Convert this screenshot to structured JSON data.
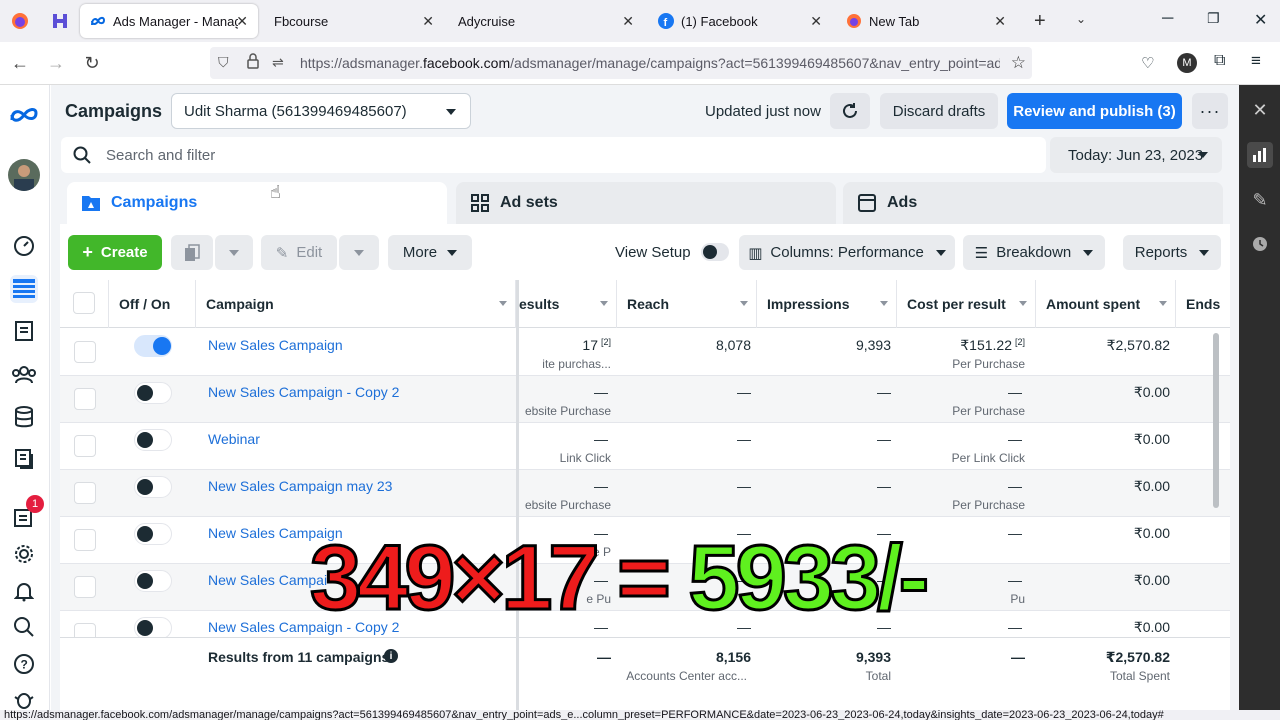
{
  "browser": {
    "tabs": [
      {
        "title": "Ads Manager - Manage",
        "active": true
      },
      {
        "title": "Fbcourse"
      },
      {
        "title": "Adycruise"
      },
      {
        "title": "(1) Facebook"
      },
      {
        "title": "New Tab"
      }
    ],
    "url": "https://adsmanager.facebook.com/adsmanager/manage/campaigns?act=561399469485607&nav_entry_point=ads",
    "url_prefix": "https://adsmanager.",
    "url_domain": "facebook.com",
    "url_suffix": "/adsmanager/manage/campaigns?act=561399469485607&nav_entry_point=ads",
    "profile_initial": "M",
    "status_url": "https://adsmanager.facebook.com/adsmanager/manage/campaigns?act=561399469485607&nav_entry_point=ads_e...column_preset=PERFORMANCE&date=2023-06-23_2023-06-24,today&insights_date=2023-06-23_2023-06-24,today#"
  },
  "sidebar": {
    "notification_count": "1"
  },
  "header": {
    "title": "Campaigns",
    "account": "Udit Sharma (561399469485607)",
    "updated": "Updated just now",
    "discard": "Discard drafts",
    "publish": "Review and publish (3)",
    "search_placeholder": "Search and filter",
    "date": "Today: Jun 23, 2023"
  },
  "level_tabs": {
    "campaigns": "Campaigns",
    "adsets": "Ad sets",
    "ads": "Ads"
  },
  "toolbar": {
    "create": "Create",
    "edit": "Edit",
    "more": "More",
    "view_setup": "View Setup",
    "columns": "Columns: Performance",
    "breakdown": "Breakdown",
    "reports": "Reports"
  },
  "table": {
    "headers": {
      "off_on": "Off / On",
      "campaign": "Campaign",
      "results": "esults",
      "reach": "Reach",
      "impressions": "Impressions",
      "cost": "Cost per result",
      "amount": "Amount spent",
      "ends": "Ends"
    },
    "rows": [
      {
        "name": "New Sales Campaign",
        "on": true,
        "results": "17",
        "results_sup": "[2]",
        "results_sub": "ite purchas...",
        "reach": "8,078",
        "impressions": "9,393",
        "cost": "₹151.22",
        "cost_sup": "[2]",
        "cost_sub": "Per Purchase",
        "amount": "₹2,570.82"
      },
      {
        "name": "New Sales Campaign - Copy 2",
        "on": false,
        "results": "—",
        "results_sup": "",
        "results_sub": "ebsite Purchase",
        "reach": "—",
        "impressions": "—",
        "cost": "—",
        "cost_sup": "",
        "cost_sub": "Per Purchase",
        "amount": "₹0.00"
      },
      {
        "name": "Webinar",
        "on": false,
        "results": "—",
        "results_sup": "",
        "results_sub": "Link Click",
        "reach": "—",
        "impressions": "—",
        "cost": "—",
        "cost_sup": "",
        "cost_sub": "Per Link Click",
        "amount": "₹0.00"
      },
      {
        "name": "New Sales Campaign may 23",
        "on": false,
        "results": "—",
        "results_sup": "",
        "results_sub": "ebsite Purchase",
        "reach": "—",
        "impressions": "—",
        "cost": "—",
        "cost_sup": "",
        "cost_sub": "Per Purchase",
        "amount": "₹0.00"
      },
      {
        "name": "New Sales Campaign",
        "on": false,
        "results": "—",
        "results_sup": "",
        "results_sub": "ebsite P",
        "reach": "—",
        "impressions": "—",
        "cost": "—",
        "cost_sup": "",
        "cost_sub": "",
        "amount": "₹0.00"
      },
      {
        "name": "New Sales Campai",
        "on": false,
        "results": "—",
        "results_sup": "",
        "results_sub": "e Pu",
        "reach": "—",
        "impressions": "—",
        "cost": "—",
        "cost_sup": "",
        "cost_sub": "Pu",
        "amount": "₹0.00"
      },
      {
        "name": "New Sales Campaign - Copy 2",
        "on": false,
        "results": "—",
        "results_sup": "",
        "results_sub": "",
        "reach": "—",
        "impressions": "—",
        "cost": "—",
        "cost_sup": "",
        "cost_sub": "",
        "amount": "₹0.00"
      }
    ],
    "footer": {
      "label": "Results from 11 campaigns",
      "results": "—",
      "reach": "8,156",
      "reach_sub": "Accounts Center acc...",
      "impressions": "9,393",
      "impressions_sub": "Total",
      "cost": "—",
      "amount": "₹2,570.82",
      "amount_sub": "Total Spent"
    }
  },
  "overlay": {
    "left": "349×17 =",
    "right": "5933/-"
  },
  "colors": {
    "accent": "#1877f2",
    "create": "#42b72a",
    "overlay_red": "#ee1c1c",
    "overlay_green": "#5ff01f"
  }
}
